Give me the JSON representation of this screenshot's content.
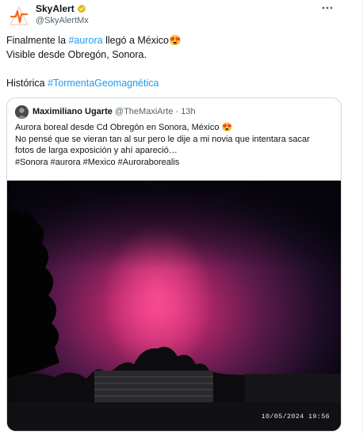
{
  "author": {
    "name": "SkyAlert",
    "handle": "@SkyAlertMx"
  },
  "icons": {
    "avatar": "skyalert-logo-icon",
    "verified": "gold-verified-badge-icon",
    "more": "more-options-icon"
  },
  "post": {
    "line1_prefix": "Finalmente la ",
    "line1_link": "#aurora",
    "line1_suffix": " llegó a México",
    "line1_emoji": "😍",
    "line2": "Visible desde Obregón, Sonora.",
    "line3_prefix": "Histórica ",
    "line3_link": "#TormentaGeomagnética"
  },
  "quote": {
    "name": "Maximiliano Ugarte",
    "handle": "@TheMaxiArte",
    "separator": "·",
    "time": "13h",
    "line1": "Aurora boreal desde Cd Obregón en Sonora, México",
    "line1_emoji": "😍",
    "line2": "No pensé que se vieran tan al sur pero le dije a mi novia que intentara sacar",
    "line3": "fotos de larga exposición y ahí apareció…",
    "line4": "#Sonora #aurora #Mexico #Auroraborealis",
    "photo_timestamp": "10/05/2024  19:56"
  },
  "colors": {
    "link": "#1d9bf0",
    "verified": "#e2b719",
    "brand": "#f26a21",
    "aurora": "#d92f7a"
  }
}
